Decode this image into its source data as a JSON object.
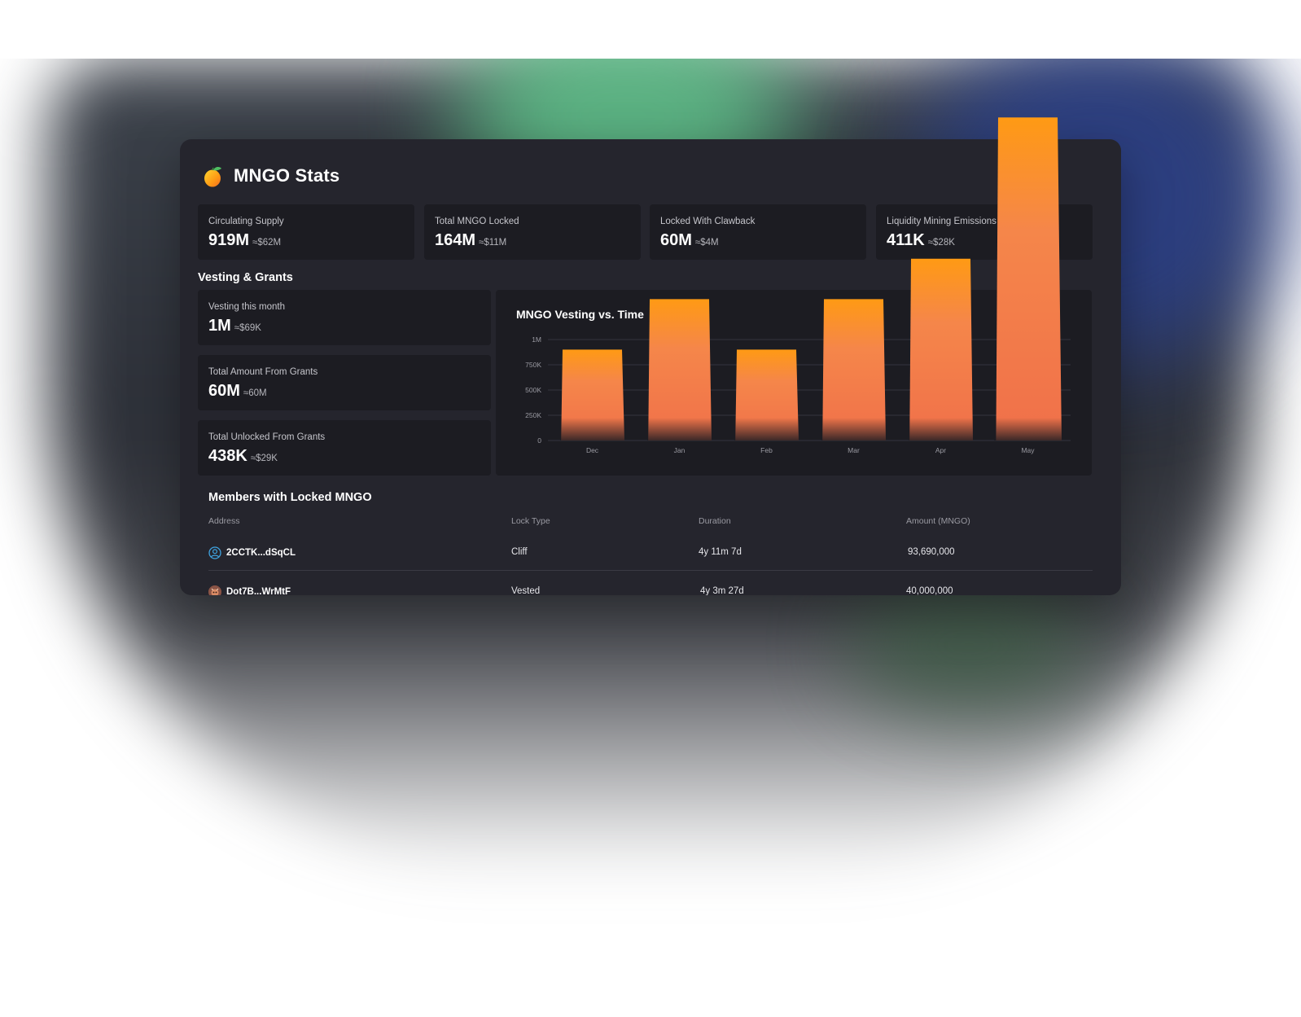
{
  "header": {
    "title": "MNGO Stats",
    "logo_icon": "mango-icon"
  },
  "stats": [
    {
      "label": "Circulating Supply",
      "value": "919M",
      "approx": "≈$62M"
    },
    {
      "label": "Total MNGO Locked",
      "value": "164M",
      "approx": "≈$11M"
    },
    {
      "label": "Locked With Clawback",
      "value": "60M",
      "approx": "≈$4M"
    },
    {
      "label": "Liquidity Mining Emissions",
      "value": "411K",
      "approx": "≈$28K"
    }
  ],
  "vesting": {
    "section_title": "Vesting & Grants",
    "cards": [
      {
        "label": "Vesting this month",
        "value": "1M",
        "approx": "≈$69K"
      },
      {
        "label": "Total Amount From Grants",
        "value": "60M",
        "approx": "≈60M"
      },
      {
        "label": "Total Unlocked From Grants",
        "value": "438K",
        "approx": "≈$29K"
      }
    ]
  },
  "chart_data": {
    "type": "bar",
    "title": "MNGO Vesting vs. Time",
    "categories": [
      "Dec",
      "Jan",
      "Feb",
      "Mar",
      "Apr",
      "May"
    ],
    "values": [
      900000,
      1400000,
      900000,
      1400000,
      1800000,
      3200000
    ],
    "y_ticks": [
      "0",
      "250K",
      "500K",
      "750K",
      "1M"
    ],
    "ylim": [
      0,
      1000000
    ],
    "colors": {
      "top": "#ff9a14",
      "bottom": "#f0704a"
    },
    "grid": true
  },
  "members": {
    "title": "Members with Locked MNGO",
    "columns": [
      "Address",
      "Lock Type",
      "Duration",
      "Amount (MNGO)"
    ],
    "rows": [
      {
        "address": "2CCTK...dSqCL",
        "lock_type": "Cliff",
        "duration": "4y 11m 7d",
        "amount": "93,690,000",
        "avatar_icon": "user-outline-icon"
      },
      {
        "address": "Dot7B...WrMtF",
        "lock_type": "Vested",
        "duration": "4y 3m 27d",
        "amount": "40,000,000",
        "avatar_icon": "nft-avatar-icon"
      }
    ]
  }
}
